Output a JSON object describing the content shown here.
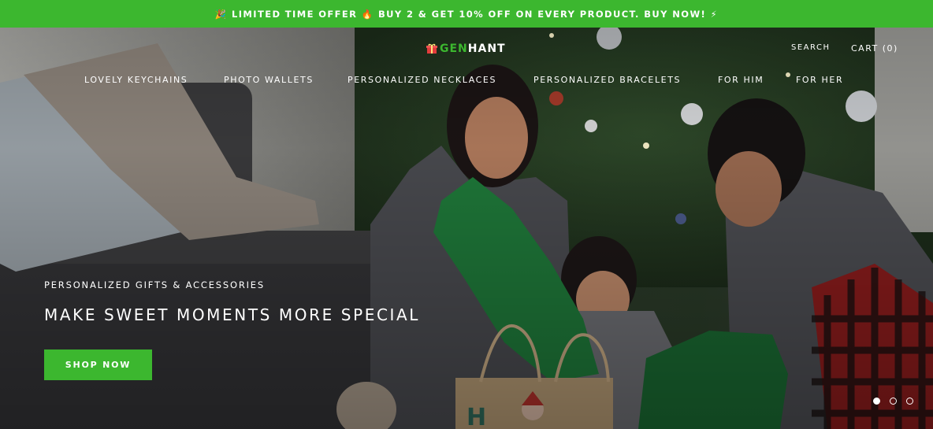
{
  "announcement": {
    "text": "🎉 LIMITED TIME OFFER 🔥 BUY 2 & GET 10% OFF ON EVERY PRODUCT. BUY NOW! ⚡"
  },
  "header": {
    "logo_prefix": "GEN",
    "logo_suffix": "HANT",
    "search_label": "SEARCH",
    "cart_label": "CART (0)"
  },
  "nav": {
    "items": [
      {
        "label": "LOVELY KEYCHAINS"
      },
      {
        "label": "PHOTO WALLETS"
      },
      {
        "label": "PERSONALIZED NECKLACES"
      },
      {
        "label": "PERSONALIZED BRACELETS"
      },
      {
        "label": "FOR HIM"
      },
      {
        "label": "FOR HER"
      }
    ]
  },
  "hero": {
    "eyebrow": "PERSONALIZED GIFTS & ACCESSORIES",
    "headline": "MAKE SWEET MOMENTS MORE SPECIAL",
    "cta_label": "SHOP NOW",
    "slides_total": 3,
    "active_slide": 1
  },
  "colors": {
    "brand_green": "#3cb72f",
    "text": "#ffffff"
  }
}
